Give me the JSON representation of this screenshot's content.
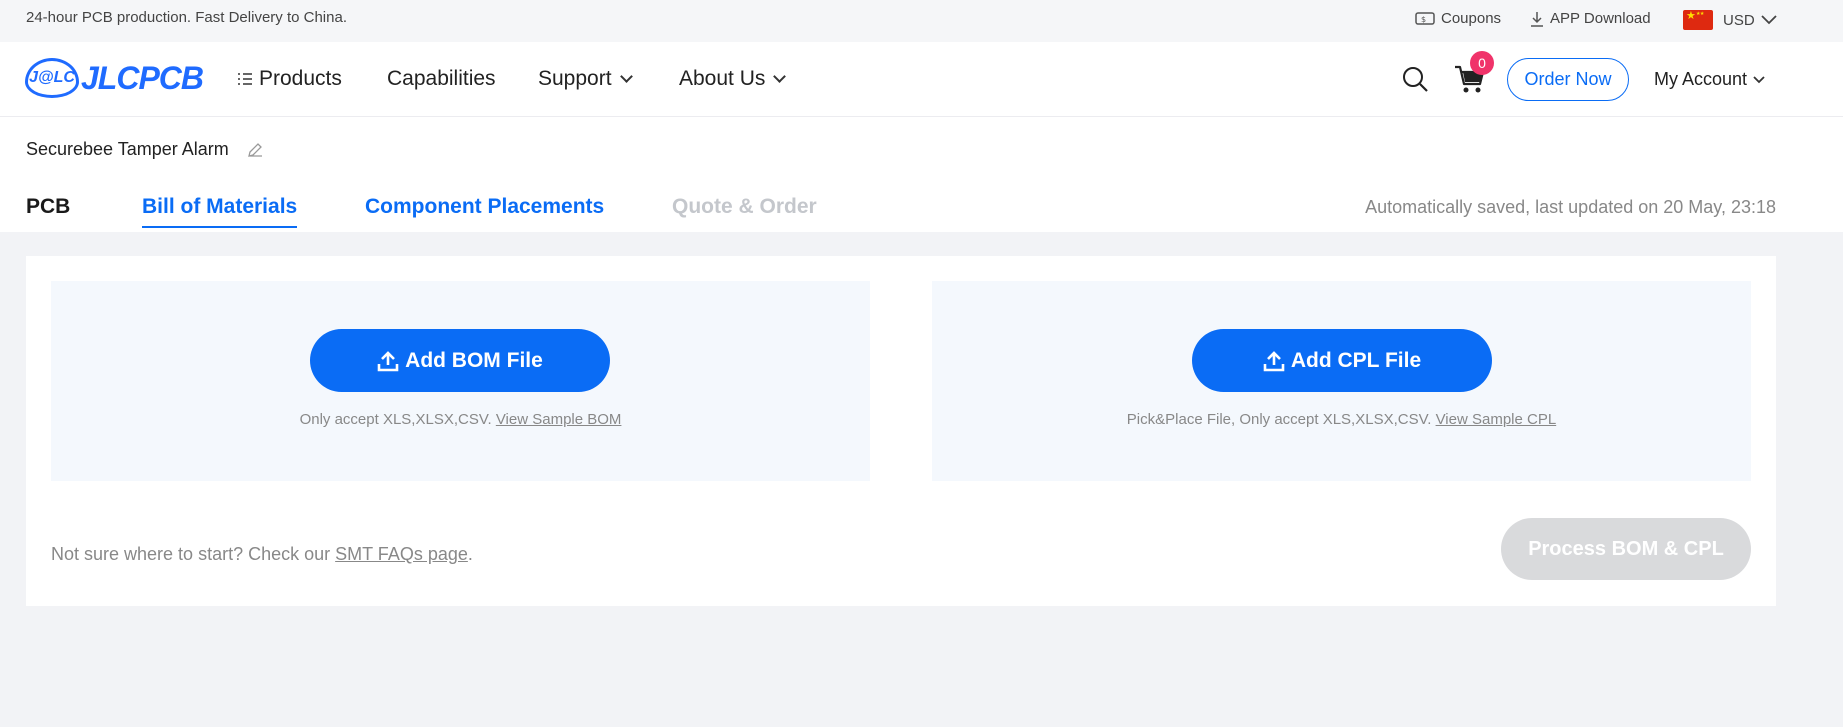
{
  "topbar": {
    "promo": "24-hour PCB production. Fast Delivery to China.",
    "coupons": "Coupons",
    "app_download": "APP Download",
    "currency": "USD"
  },
  "nav": {
    "logo_mark": "J@LC",
    "logo_text": "JLCPCB",
    "products": "Products",
    "capabilities": "Capabilities",
    "support": "Support",
    "about": "About Us",
    "cart_count": "0",
    "order_now": "Order Now",
    "account": "My Account"
  },
  "project": {
    "name": "Securebee Tamper Alarm",
    "saved_status": "Automatically saved, last updated on 20 May, 23:18"
  },
  "tabs": {
    "pcb": "PCB",
    "bom": "Bill of Materials",
    "cpl": "Component Placements",
    "quote": "Quote & Order",
    "active": "bom"
  },
  "bom_panel": {
    "button": "Add BOM File",
    "note": "Only accept XLS,XLSX,CSV.",
    "link": "View Sample BOM"
  },
  "cpl_panel": {
    "button": "Add CPL File",
    "note": "Pick&Place File, Only accept XLS,XLSX,CSV.",
    "link": "View Sample CPL"
  },
  "footer": {
    "start_text": "Not sure where to start? Check our",
    "faq_link": "SMT FAQs page",
    "start_suffix": ".",
    "process_button": "Process BOM & CPL"
  },
  "colors": {
    "accent": "#0a6cf5",
    "badge": "#f0336a",
    "disabled": "#d9dadc"
  }
}
